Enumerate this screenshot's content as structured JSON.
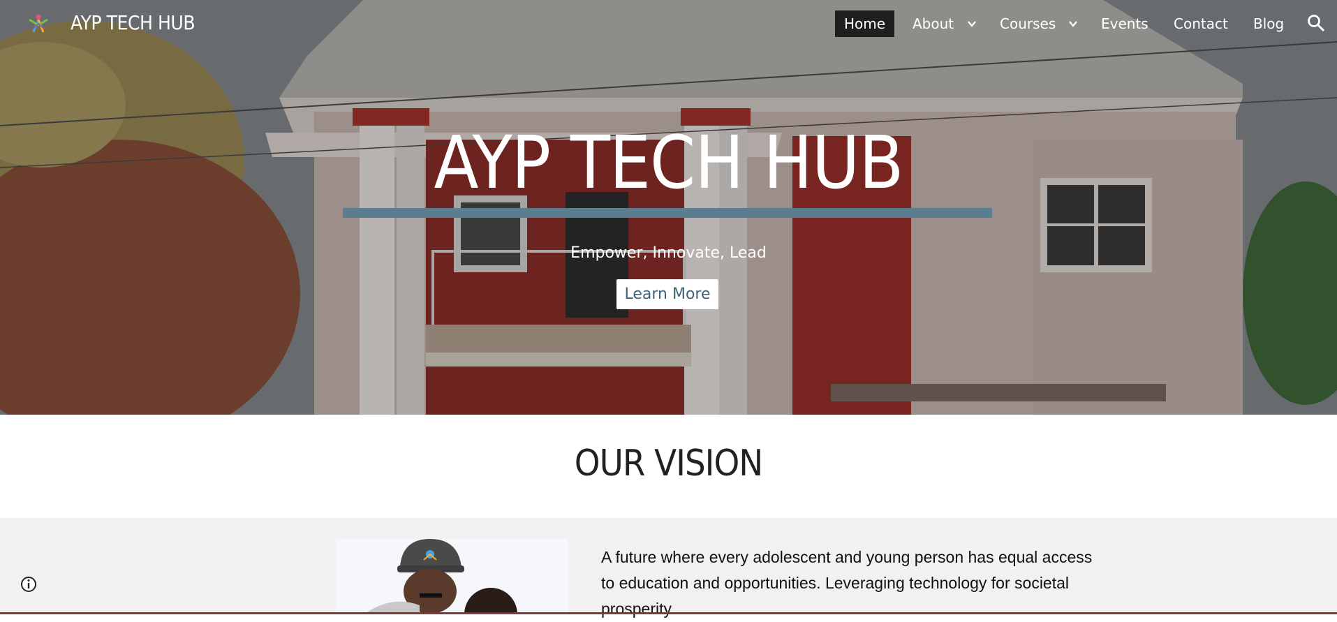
{
  "site": {
    "title": "AYP TECH HUB",
    "accent": "#5b7d90",
    "text_on_dark": "#ffffff"
  },
  "nav": {
    "items": [
      {
        "label": "Home",
        "active": true
      },
      {
        "label": "About",
        "has_dropdown": true
      },
      {
        "label": "Courses",
        "has_dropdown": true
      },
      {
        "label": "Events"
      },
      {
        "label": "Contact"
      },
      {
        "label": "Blog"
      }
    ],
    "search_icon": "search-icon",
    "dropdown_icon": "chevron-down-icon"
  },
  "hero": {
    "title": "AYP TECH HUB",
    "tagline": "Empower, Innovate, Lead",
    "cta_label": "Learn More",
    "cta_color": "#3f6479"
  },
  "vision": {
    "title": "OUR VISION",
    "text": "A future where every adolescent and young person has equal access to education and opportunities. Leveraging technology for societal prosperity."
  },
  "footer": {
    "info_icon": "info-icon"
  }
}
